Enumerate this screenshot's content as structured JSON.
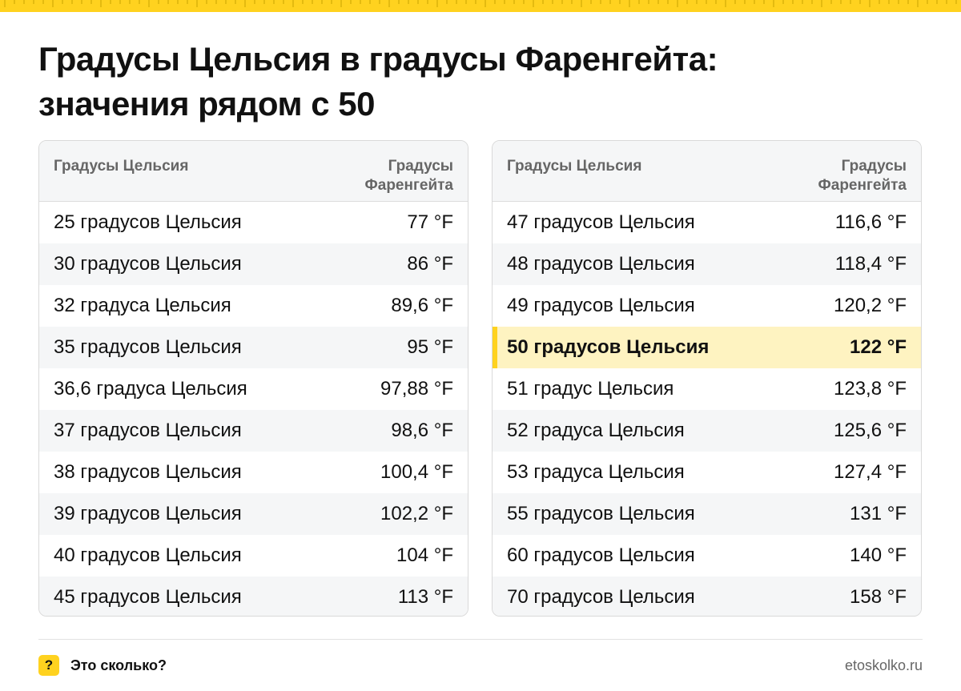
{
  "title": {
    "line1": "Градусы Цельсия в градусы Фаренгейта:",
    "line2": "значения рядом с 50"
  },
  "colors": {
    "accent": "#ffd21f",
    "highlight_row": "#fef3c1",
    "row_alt": "#f5f6f7",
    "header_text": "#666666"
  },
  "tables": {
    "left": {
      "header_celsius": "Градусы Цельсия",
      "header_fahrenheit_1": "Градусы",
      "header_fahrenheit_2": "Фаренгейта",
      "rows": [
        {
          "c": "25 градусов Цельсия",
          "f": "77 °F"
        },
        {
          "c": "30 градусов Цельсия",
          "f": "86 °F"
        },
        {
          "c": "32 градуса Цельсия",
          "f": "89,6 °F"
        },
        {
          "c": "35 градусов Цельсия",
          "f": "95 °F"
        },
        {
          "c": "36,6 градуса Цельсия",
          "f": "97,88 °F"
        },
        {
          "c": "37 градусов Цельсия",
          "f": "98,6 °F"
        },
        {
          "c": "38 градусов Цельсия",
          "f": "100,4 °F"
        },
        {
          "c": "39 градусов Цельсия",
          "f": "102,2 °F"
        },
        {
          "c": "40 градусов Цельсия",
          "f": "104 °F"
        },
        {
          "c": "45 градусов Цельсия",
          "f": "113 °F"
        }
      ]
    },
    "right": {
      "header_celsius": "Градусы Цельсия",
      "header_fahrenheit_1": "Градусы",
      "header_fahrenheit_2": "Фаренгейта",
      "rows": [
        {
          "c": "47 градусов Цельсия",
          "f": "116,6 °F"
        },
        {
          "c": "48 градусов Цельсия",
          "f": "118,4 °F"
        },
        {
          "c": "49 градусов Цельсия",
          "f": "120,2 °F"
        },
        {
          "c": "50 градусов Цельсия",
          "f": "122 °F",
          "highlighted": true
        },
        {
          "c": "51 градус Цельсия",
          "f": "123,8 °F"
        },
        {
          "c": "52 градуса Цельсия",
          "f": "125,6 °F"
        },
        {
          "c": "53 градуса Цельсия",
          "f": "127,4 °F"
        },
        {
          "c": "55 градусов Цельсия",
          "f": "131 °F"
        },
        {
          "c": "60 градусов Цельсия",
          "f": "140 °F"
        },
        {
          "c": "70 градусов Цельсия",
          "f": "158 °F"
        }
      ]
    }
  },
  "footer": {
    "badge": "?",
    "brand": "Это сколько?",
    "site": "etoskolko.ru"
  }
}
